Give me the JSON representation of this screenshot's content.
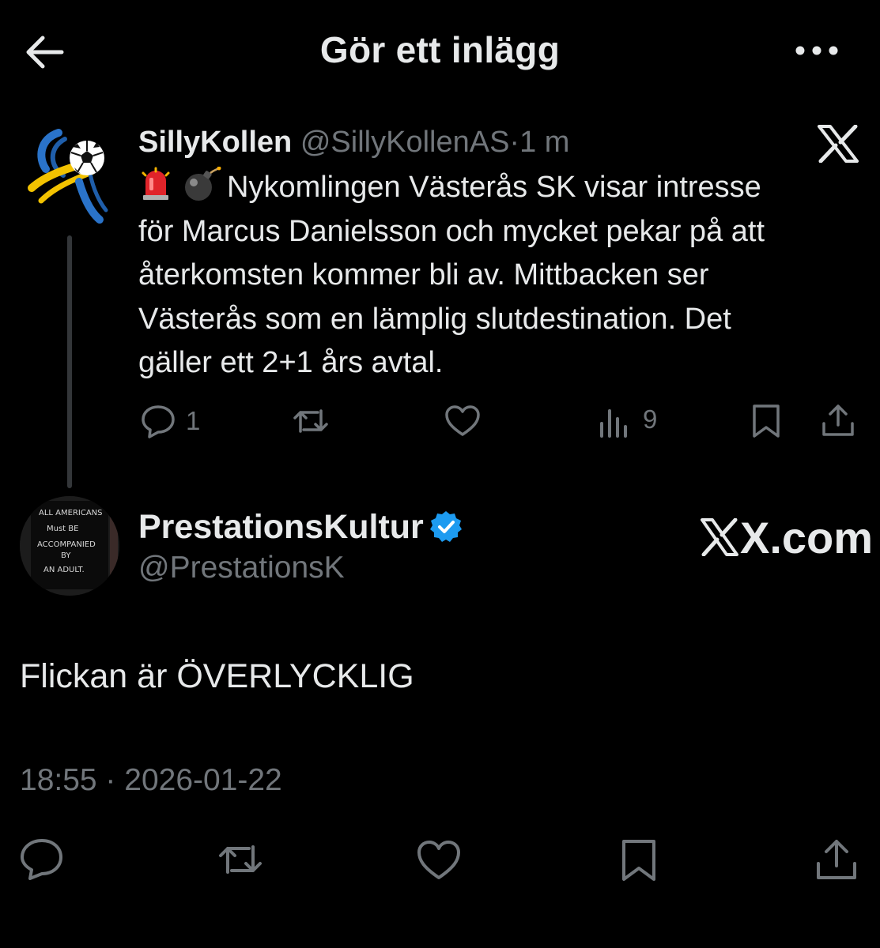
{
  "header": {
    "title": "Gör ett inlägg",
    "back_icon": "arrow-left-icon",
    "more_icon": "more-horizontal-icon"
  },
  "quoted_tweet": {
    "display_name": "SillyKollen",
    "handle": "@SillyKollenAS",
    "separator": "·",
    "time": "1 m",
    "emojis": [
      "rotating-light-emoji",
      "bomb-emoji"
    ],
    "text_lines": [
      "Nykomlingen Västerås SK visar intresse",
      "för Marcus Danielsson och mycket pekar på att",
      "återkomsten kommer bli av. Mittbacken ser",
      "Västerås som en lämplig slutdestination. Det",
      "gäller ett 2+1 års avtal."
    ],
    "actions": {
      "replies": "1",
      "views": "9"
    }
  },
  "main_tweet": {
    "display_name": "PrestationsKultur",
    "handle": "@PrestationsK",
    "verified": true,
    "watermark": "X.com",
    "text": "Flickan är ÖVERLYCKLIG",
    "timestamp": "18:55 · 2026-01-22",
    "avatar_sign_text": "ALL AMERICANS MUST BE ACCOMPANIED BY AN ADULT."
  },
  "colors": {
    "background": "#000000",
    "text_primary": "#e7e9ea",
    "text_secondary": "#71767b",
    "verified_blue": "#1d9bf0",
    "thread_line": "#333639"
  }
}
